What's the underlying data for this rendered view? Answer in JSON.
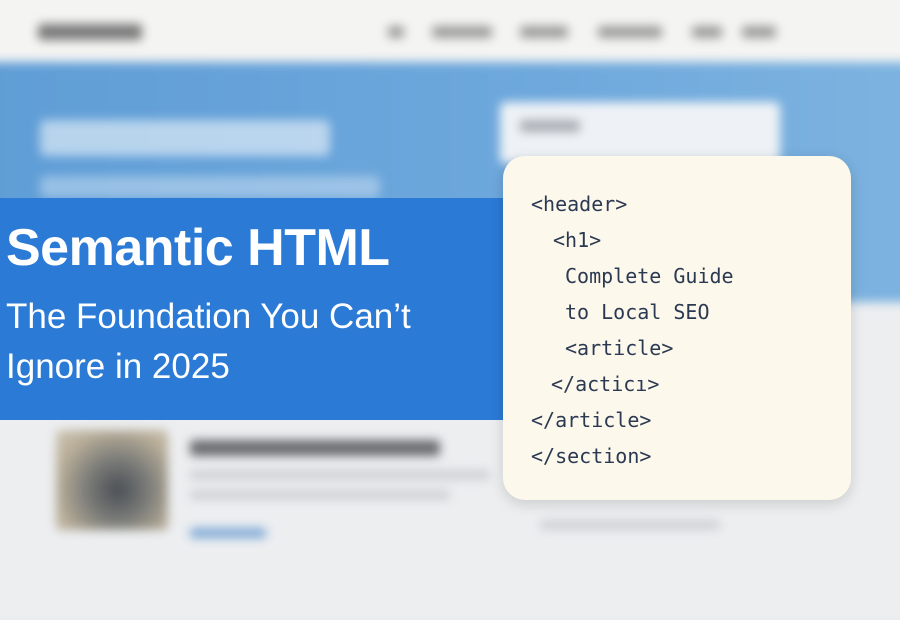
{
  "headline": {
    "title": "Semantic HTML",
    "subtitle": "The Foundation You Can’t Ignore in 2025"
  },
  "code_snippet": {
    "lines": [
      {
        "text": "<header>",
        "indent": 0
      },
      {
        "text": "<h1>",
        "indent": 1
      },
      {
        "text": "Complete Guide",
        "indent": 2
      },
      {
        "text": "to Local SEO",
        "indent": 2
      },
      {
        "text": "<article>",
        "indent": 2
      },
      {
        "text": "</acticı>",
        "indent": 1
      },
      {
        "text": "</article>",
        "indent": 0
      },
      {
        "text": "</section>",
        "indent": 0
      }
    ]
  },
  "colors": {
    "banner": "#2a7ad6",
    "card_background": "#fdf8ec",
    "code_text": "#2b3a52"
  }
}
